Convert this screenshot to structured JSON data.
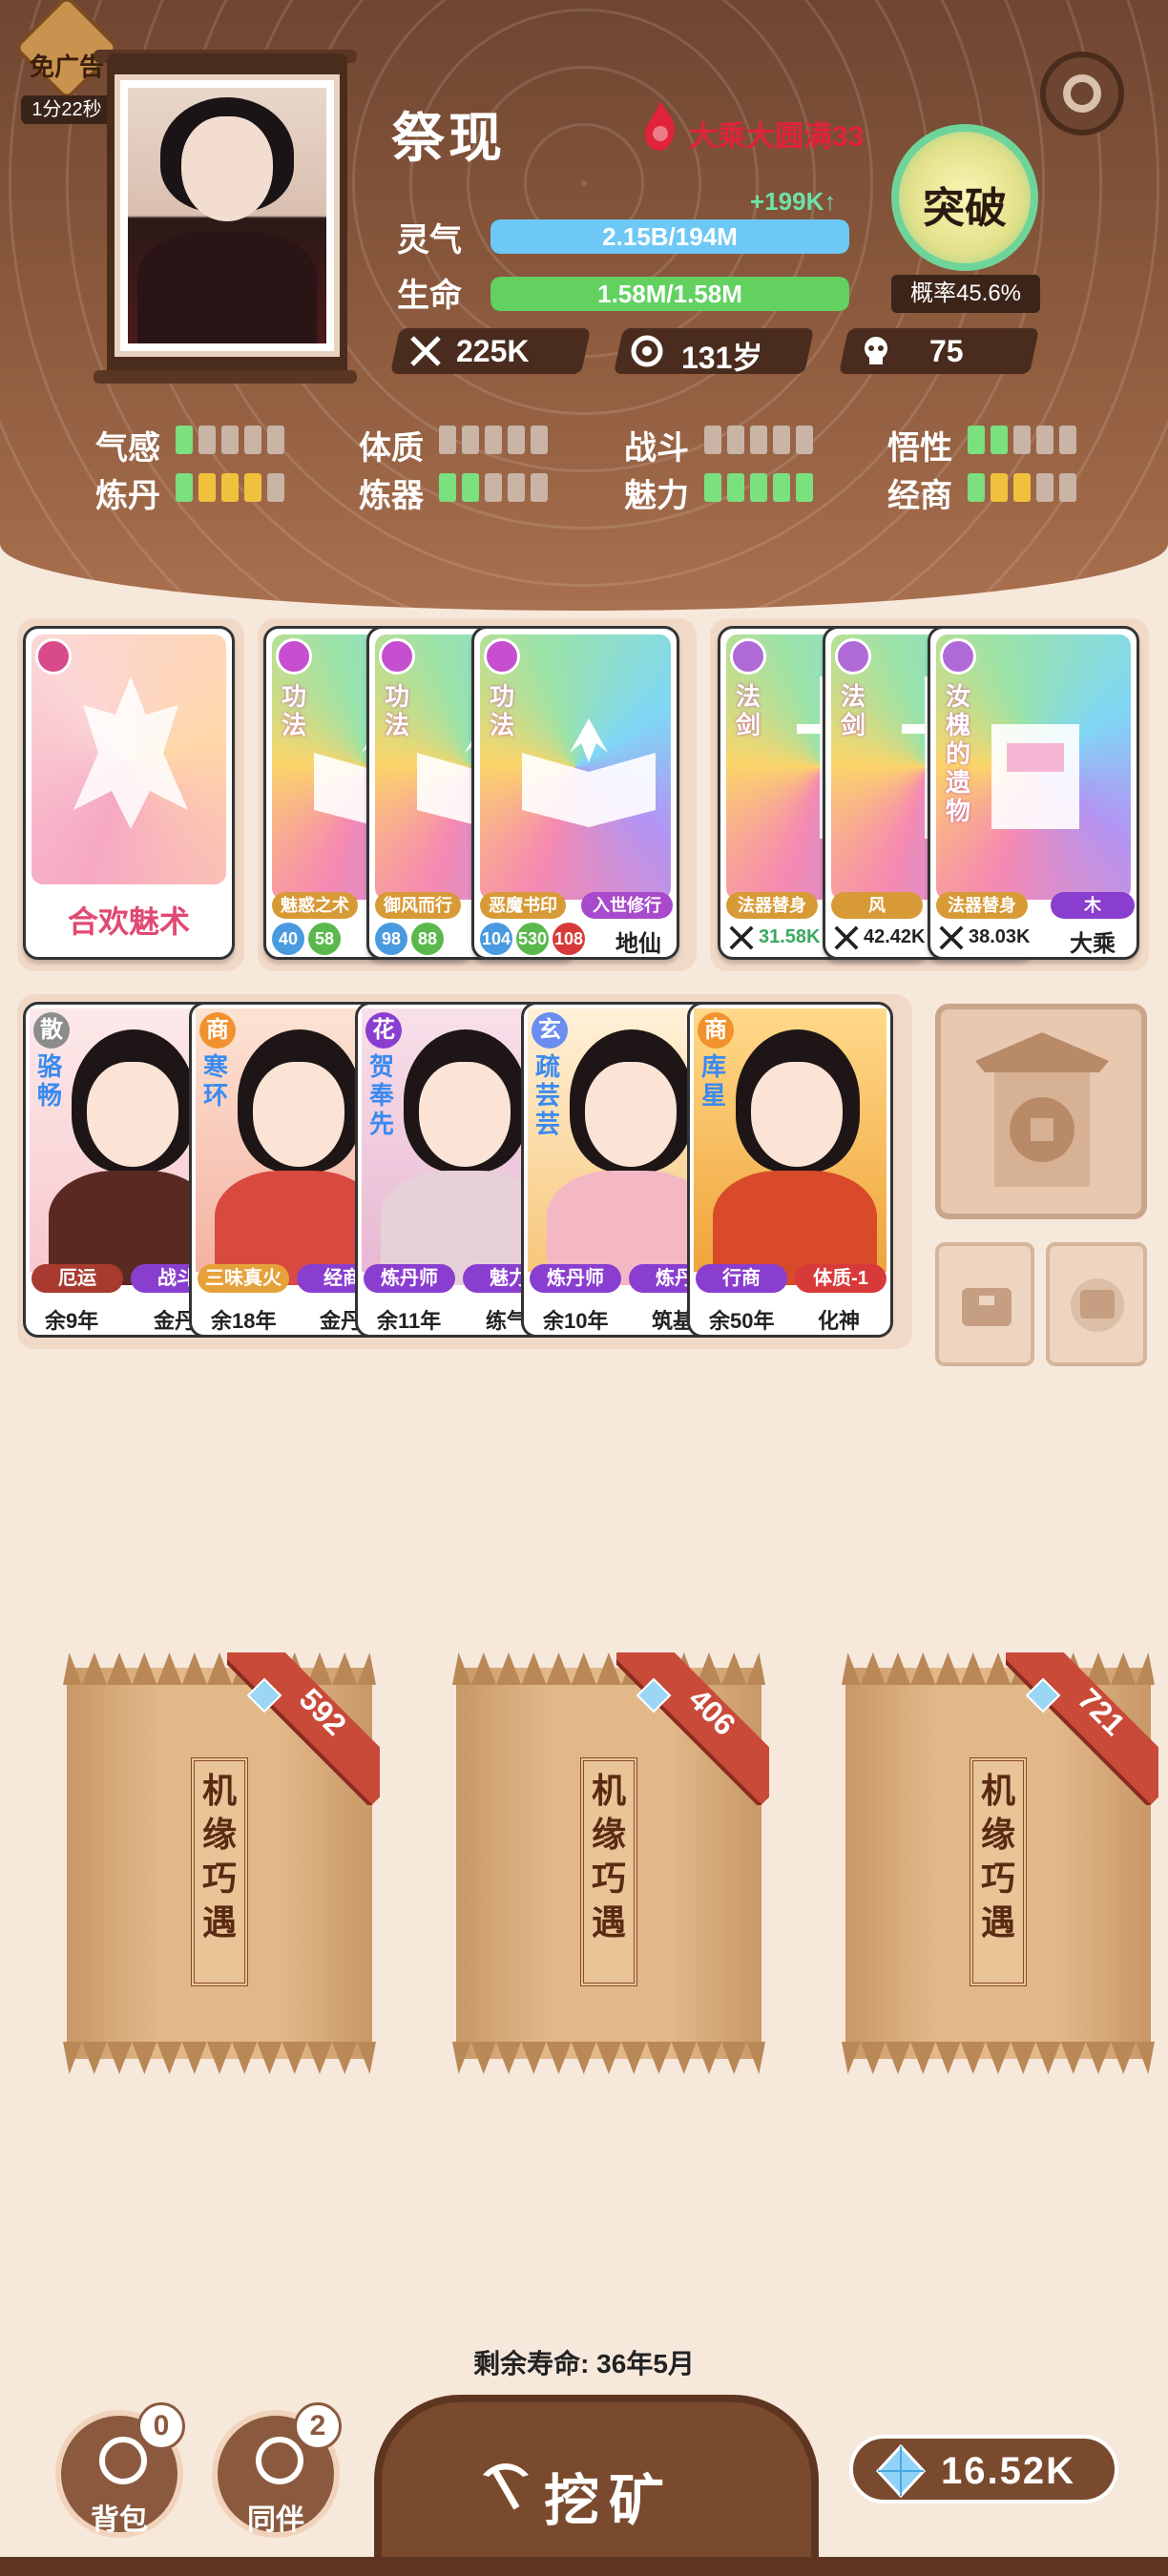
{
  "ad": {
    "label": "免广告",
    "timer": "1分22秒"
  },
  "character": {
    "name": "祭现",
    "realm": "大乘大圆满33"
  },
  "stats": {
    "lingqi": {
      "label": "灵气",
      "value": "2.15B/194M",
      "fill": 1.0,
      "gain": "+199K↑"
    },
    "life": {
      "label": "生命",
      "value": "1.58M/1.58M",
      "fill": 1.0
    }
  },
  "breakthrough": {
    "label": "突破",
    "probability": "概率45.6%"
  },
  "pills": {
    "power": "225K",
    "age": "131岁",
    "kills": "75"
  },
  "attributes": [
    {
      "label": "气感",
      "levels": [
        "g",
        "e",
        "e",
        "e",
        "e"
      ]
    },
    {
      "label": "体质",
      "levels": [
        "e",
        "e",
        "e",
        "e",
        "e"
      ]
    },
    {
      "label": "战斗",
      "levels": [
        "e",
        "e",
        "e",
        "e",
        "e"
      ]
    },
    {
      "label": "悟性",
      "levels": [
        "g",
        "g",
        "e",
        "e",
        "e"
      ]
    },
    {
      "label": "炼丹",
      "levels": [
        "g",
        "y",
        "y",
        "y",
        "e"
      ]
    },
    {
      "label": "炼器",
      "levels": [
        "g",
        "g",
        "e",
        "e",
        "e"
      ]
    },
    {
      "label": "魅力",
      "levels": [
        "g",
        "g",
        "g",
        "g",
        "g"
      ]
    },
    {
      "label": "经商",
      "levels": [
        "g",
        "y",
        "y",
        "e",
        "e"
      ]
    }
  ],
  "skill_card": {
    "name": "合欢魅术"
  },
  "gongfa_cards": [
    {
      "vlabel": "功法",
      "tag": "魅惑之术",
      "n1": "40",
      "n2": "58"
    },
    {
      "vlabel": "功法",
      "tag": "御风而行",
      "n1": "98",
      "n2": "88"
    },
    {
      "vlabel": "功法",
      "tag": "恶魔书印",
      "tag2": "入世修行",
      "n1": "104",
      "n2": "530",
      "n3": "108",
      "rank": "地仙"
    }
  ],
  "treasure_cards": [
    {
      "vlabel": "法剑",
      "tag": "法器替身",
      "power": "31.58K"
    },
    {
      "vlabel": "法剑",
      "tag": "风",
      "power": "42.42K"
    },
    {
      "vlabel": "汝槐的遗物",
      "tag": "法器替身",
      "tag2": "木",
      "power": "38.03K",
      "rank": "大乘"
    }
  ],
  "companions": [
    {
      "badge": "散",
      "name": "骆畅",
      "tag1": "厄运",
      "tag2": "战斗",
      "life": "余9年",
      "extra": "金丹"
    },
    {
      "badge": "商",
      "name": "寒环",
      "tag1": "三味真火",
      "tag2": "经商",
      "life": "余18年",
      "extra": "金丹"
    },
    {
      "badge": "花",
      "name": "贺奉先",
      "tag1": "炼丹师",
      "tag2": "魅力",
      "life": "余11年",
      "extra": "练气"
    },
    {
      "badge": "玄",
      "name": "疏芸芸",
      "tag1": "炼丹师",
      "tag2": "炼丹",
      "life": "余10年",
      "extra": "筑基"
    },
    {
      "badge": "商",
      "name": "库星",
      "tag1": "行商",
      "tag2": "体质-1",
      "life": "余50年",
      "extra": "化神"
    }
  ],
  "chests": [
    {
      "label": "机缘巧遇",
      "cost": "592"
    },
    {
      "label": "机缘巧遇",
      "cost": "406"
    },
    {
      "label": "机缘巧遇",
      "cost": "721"
    }
  ],
  "lifetime": "剩余寿命: 36年5月",
  "bottom": {
    "bag": {
      "label": "背包",
      "count": "0"
    },
    "companion": {
      "label": "同伴",
      "count": "2"
    },
    "mine": "挖矿",
    "gems": "16.52K"
  },
  "colors": {
    "lingqi": "#6ec8f5",
    "life": "#62d160",
    "realm": "#e0233a",
    "accent": "#7a4a2e"
  }
}
